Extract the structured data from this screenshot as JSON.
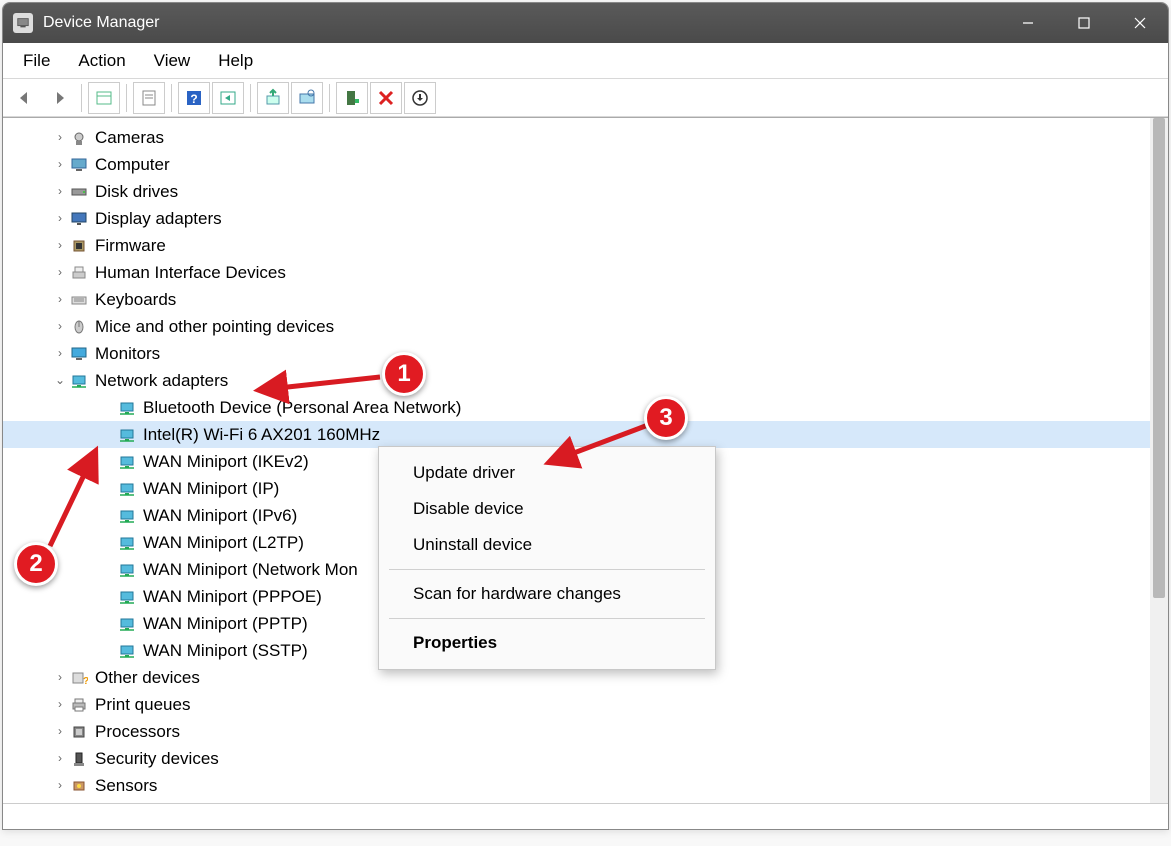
{
  "window": {
    "title": "Device Manager"
  },
  "menu": {
    "file": "File",
    "action": "Action",
    "view": "View",
    "help": "Help"
  },
  "tree": {
    "categories": [
      {
        "name": "cameras",
        "label": "Cameras",
        "expanded": false,
        "icon": "camera"
      },
      {
        "name": "computer",
        "label": "Computer",
        "expanded": false,
        "icon": "computer"
      },
      {
        "name": "disk-drives",
        "label": "Disk drives",
        "expanded": false,
        "icon": "disk"
      },
      {
        "name": "display-adapters",
        "label": "Display adapters",
        "expanded": false,
        "icon": "display"
      },
      {
        "name": "firmware",
        "label": "Firmware",
        "expanded": false,
        "icon": "chip"
      },
      {
        "name": "hid",
        "label": "Human Interface Devices",
        "expanded": false,
        "icon": "hid"
      },
      {
        "name": "keyboards",
        "label": "Keyboards",
        "expanded": false,
        "icon": "keyboard"
      },
      {
        "name": "mice",
        "label": "Mice and other pointing devices",
        "expanded": false,
        "icon": "mouse"
      },
      {
        "name": "monitors",
        "label": "Monitors",
        "expanded": false,
        "icon": "monitor"
      },
      {
        "name": "network-adapters",
        "label": "Network adapters",
        "expanded": true,
        "icon": "network",
        "children": [
          {
            "label": "Bluetooth Device (Personal Area Network)",
            "selected": false
          },
          {
            "label": "Intel(R) Wi-Fi 6 AX201 160MHz",
            "selected": true
          },
          {
            "label": "WAN Miniport (IKEv2)",
            "selected": false
          },
          {
            "label": "WAN Miniport (IP)",
            "selected": false
          },
          {
            "label": "WAN Miniport (IPv6)",
            "selected": false
          },
          {
            "label": "WAN Miniport (L2TP)",
            "selected": false
          },
          {
            "label": "WAN Miniport (Network Mon",
            "selected": false
          },
          {
            "label": "WAN Miniport (PPPOE)",
            "selected": false
          },
          {
            "label": "WAN Miniport (PPTP)",
            "selected": false
          },
          {
            "label": "WAN Miniport (SSTP)",
            "selected": false
          }
        ]
      },
      {
        "name": "other-devices",
        "label": "Other devices",
        "expanded": false,
        "icon": "other"
      },
      {
        "name": "print-queues",
        "label": "Print queues",
        "expanded": false,
        "icon": "printer"
      },
      {
        "name": "processors",
        "label": "Processors",
        "expanded": false,
        "icon": "cpu"
      },
      {
        "name": "security-devices",
        "label": "Security devices",
        "expanded": false,
        "icon": "security"
      },
      {
        "name": "sensors",
        "label": "Sensors",
        "expanded": false,
        "icon": "sensor"
      }
    ]
  },
  "contextMenu": {
    "update": "Update driver",
    "disable": "Disable device",
    "uninstall": "Uninstall device",
    "scan": "Scan for hardware changes",
    "properties": "Properties"
  },
  "annotations": {
    "b1": "1",
    "b2": "2",
    "b3": "3"
  }
}
